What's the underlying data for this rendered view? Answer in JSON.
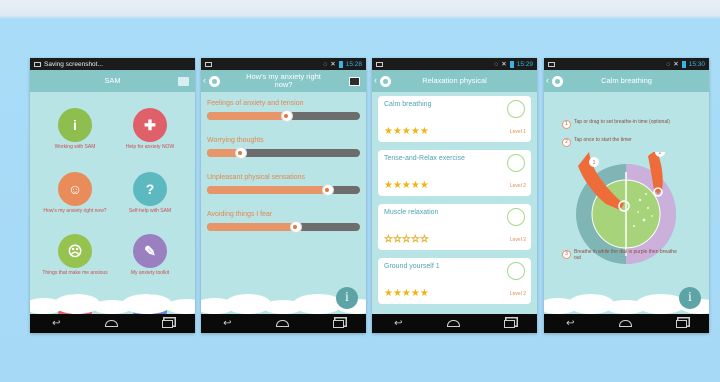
{
  "phone1": {
    "status_text": "Saving screenshot...",
    "title": "SAM",
    "tiles": [
      {
        "label": "Working with SAM",
        "icon": "info-icon",
        "glyph": "i",
        "color": "#8dbe4e"
      },
      {
        "label": "Help for anxiety NOW",
        "icon": "lifebuoy-icon",
        "glyph": "✚",
        "color": "#e0606a"
      },
      {
        "label": "How's my anxiety right now?",
        "icon": "face-icon",
        "glyph": "☺",
        "color": "#ea8c59"
      },
      {
        "label": "Self-help with SAM",
        "icon": "magnifier-icon",
        "glyph": "?",
        "color": "#5cb9c0"
      },
      {
        "label": "Things that make me anxious",
        "icon": "face-worried-icon",
        "glyph": "☹",
        "color": "#96c24f"
      },
      {
        "label": "My anxiety toolkit",
        "icon": "wrench-icon",
        "glyph": "✎",
        "color": "#9a7fc1"
      },
      {
        "label": "",
        "icon": "chart-icon",
        "glyph": "▮",
        "color": "#e0606a"
      },
      {
        "label": "",
        "icon": "chat-icon",
        "glyph": "●",
        "color": "#6f7fd6"
      }
    ]
  },
  "phone2": {
    "time": "15:28",
    "title": "How's my anxiety right now?",
    "sliders": [
      {
        "label": "Feelings of anxiety and tension",
        "value": 0.52
      },
      {
        "label": "Worrying thoughts",
        "value": 0.22
      },
      {
        "label": "Unpleasant physical sensations",
        "value": 0.79
      },
      {
        "label": "Avoiding things I fear",
        "value": 0.58
      }
    ]
  },
  "phone3": {
    "time": "15:29",
    "title": "Relaxation physical",
    "cards": [
      {
        "title": "Calm breathing",
        "stars": "★★★★★",
        "filled": true,
        "level": "Level 1",
        "badge": "(badge)"
      },
      {
        "title": "Tense-and-Relax exercise",
        "stars": "★★★★★",
        "filled": true,
        "level": "Level 2",
        "badge": "(badge)"
      },
      {
        "title": "Muscle relaxation",
        "stars": "☆☆☆☆☆",
        "filled": false,
        "level": "Level 2",
        "badge": "(badge)"
      },
      {
        "title": "Ground yourself 1",
        "stars": "★★★★★",
        "filled": true,
        "level": "Level 2",
        "badge": "(badge)"
      }
    ]
  },
  "phone4": {
    "time": "15:30",
    "title": "Calm breathing",
    "hints": [
      {
        "num": "1",
        "text": "Tap or drag to set breathe-in time (optional)"
      },
      {
        "num": "2",
        "text": "Tap once to start the timer"
      },
      {
        "num": "3",
        "text": "Breathe in while the dial is purple then breathe out"
      }
    ]
  }
}
